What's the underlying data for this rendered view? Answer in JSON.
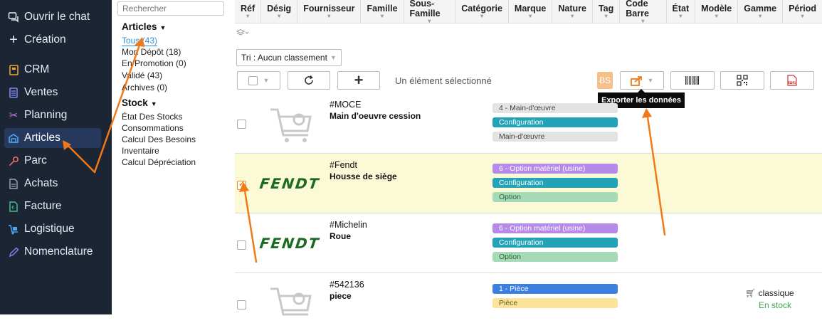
{
  "nav": {
    "items": [
      {
        "label": "Ouvrir le chat",
        "icon": "chat-icon",
        "color": "#e8ecf2"
      },
      {
        "label": "Création",
        "icon": "plus-icon",
        "color": "#e8ecf2"
      },
      {
        "label": "CRM",
        "icon": "crm-icon",
        "color": "#e8a53a"
      },
      {
        "label": "Ventes",
        "icon": "sales-icon",
        "color": "#7c86f0"
      },
      {
        "label": "Planning",
        "icon": "planning-icon",
        "color": "#c77ae0"
      },
      {
        "label": "Articles",
        "icon": "articles-icon",
        "color": "#4ea6f0"
      },
      {
        "label": "Parc",
        "icon": "key-icon",
        "color": "#e86a6a"
      },
      {
        "label": "Achats",
        "icon": "document-icon",
        "color": "#9aa3b0"
      },
      {
        "label": "Facture",
        "icon": "invoice-icon",
        "color": "#3cc08a"
      },
      {
        "label": "Logistique",
        "icon": "logistics-icon",
        "color": "#4ea6f0"
      },
      {
        "label": "Nomenclature",
        "icon": "pen-icon",
        "color": "#8c7ae8"
      }
    ]
  },
  "sub": {
    "search_placeholder": "Rechercher",
    "articles_heading": "Articles",
    "articles_items": [
      "Tous (43)",
      "Mon Dépôt (18)",
      "En Promotion (0)",
      "Validé (43)",
      "Archives (0)"
    ],
    "stock_heading": "Stock",
    "stock_items": [
      "État Des Stocks",
      "Consommations",
      "Calcul Des Besoins",
      "Inventaire",
      "Calcul Dépréciation"
    ]
  },
  "columns": [
    "Réf",
    "Désig",
    "Fournisseur",
    "Famille",
    "Sous-Famille",
    "Catégorie",
    "Marque",
    "Nature",
    "Tag",
    "Code Barre",
    "État",
    "Modèle",
    "Gamme",
    "Périod"
  ],
  "toolbar": {
    "sort_label": "Tri : Aucun classement",
    "selection_text": "Un élément sélectionné",
    "bs_label": "BS",
    "tooltip": "Exporter les données",
    "pdf_label": "PDF"
  },
  "rows": [
    {
      "ref": "#MOCE",
      "name": "Main d'oeuvre cession",
      "image": "cart-placeholder",
      "checked": false,
      "tags": [
        {
          "label": "4 - Main-d'œuvre",
          "color": "gray"
        },
        {
          "label": "Configuration",
          "color": "teal"
        },
        {
          "label": "Main-d'œuvre",
          "color": "gray"
        }
      ]
    },
    {
      "ref": "#Fendt",
      "name": "Housse de siège",
      "image": "fendt-logo",
      "logo_text": "FENDT",
      "checked": true,
      "tags": [
        {
          "label": "6 - Option matériel (usine)",
          "color": "purple"
        },
        {
          "label": "Configuration",
          "color": "teal"
        },
        {
          "label": "Option",
          "color": "green"
        }
      ]
    },
    {
      "ref": "#Michelin",
      "name": "Roue",
      "image": "fendt-logo",
      "logo_text": "FENDT",
      "checked": false,
      "tags": [
        {
          "label": "6 - Option matériel (usine)",
          "color": "purple"
        },
        {
          "label": "Configuration",
          "color": "teal"
        },
        {
          "label": "Option",
          "color": "green"
        }
      ]
    },
    {
      "ref": "#542136",
      "name": "piece",
      "image": "cart-placeholder",
      "checked": false,
      "tags": [
        {
          "label": "1 - Pièce",
          "color": "blue"
        },
        {
          "label": "Pièce",
          "color": "yellow"
        }
      ],
      "extra": {
        "type_label": "classique",
        "stock_label": "En stock"
      }
    }
  ],
  "colors": {
    "arrow": "#f07a1a",
    "accent": "#2f8fd8",
    "highlight_row": "#fcf9d7",
    "nav_bg": "#1c2534"
  }
}
